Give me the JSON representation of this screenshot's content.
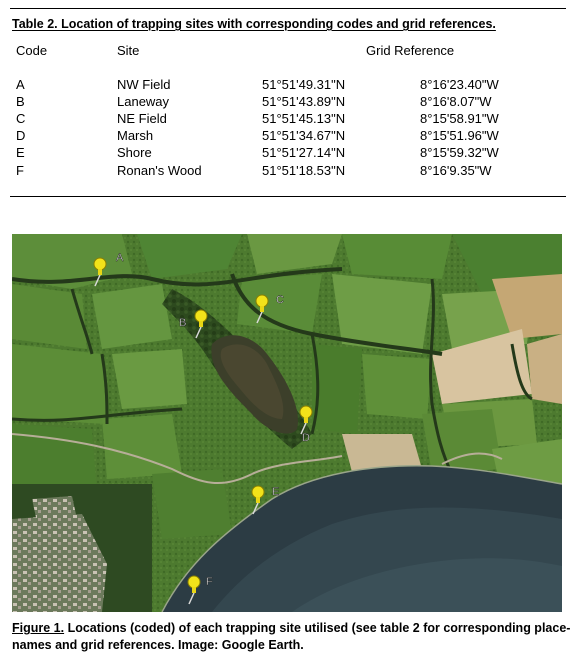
{
  "table": {
    "caption": "Table 2. Location of trapping sites with corresponding codes and grid references.",
    "headers": {
      "code": "Code",
      "site": "Site",
      "grid": "Grid Reference"
    },
    "rows": [
      {
        "code": "A",
        "site": "NW Field",
        "lat": "51°51'49.31\"N",
        "lon": "8°16'23.40\"W"
      },
      {
        "code": "B",
        "site": "Laneway",
        "lat": "51°51'43.89\"N",
        "lon": "8°16'8.07\"W"
      },
      {
        "code": "C",
        "site": "NE Field",
        "lat": "51°51'45.13\"N",
        "lon": "8°15'58.91\"W"
      },
      {
        "code": "D",
        "site": "Marsh",
        "lat": "51°51'34.67\"N",
        "lon": "8°15'51.96\"W"
      },
      {
        "code": "E",
        "site": "Shore",
        "lat": "51°51'27.14\"N",
        "lon": "8°15'59.32\"W"
      },
      {
        "code": "F",
        "site": "Ronan's Wood",
        "lat": "51°51'18.53\"N",
        "lon": "8°16'9.35\"W"
      }
    ]
  },
  "figure": {
    "caption_lead": "Figure 1.",
    "caption_rest": " Locations (coded) of each trapping site utilised (see table 2 for corresponding place-names and grid references. Image: Google Earth.",
    "map_labels": {
      "a": "A",
      "b": "B",
      "c": "C",
      "d": "D",
      "e": "E",
      "f": "F"
    },
    "pin_color": "#f2e21a",
    "water_color": "#2c3c44",
    "field_color": "#4e7a30"
  }
}
